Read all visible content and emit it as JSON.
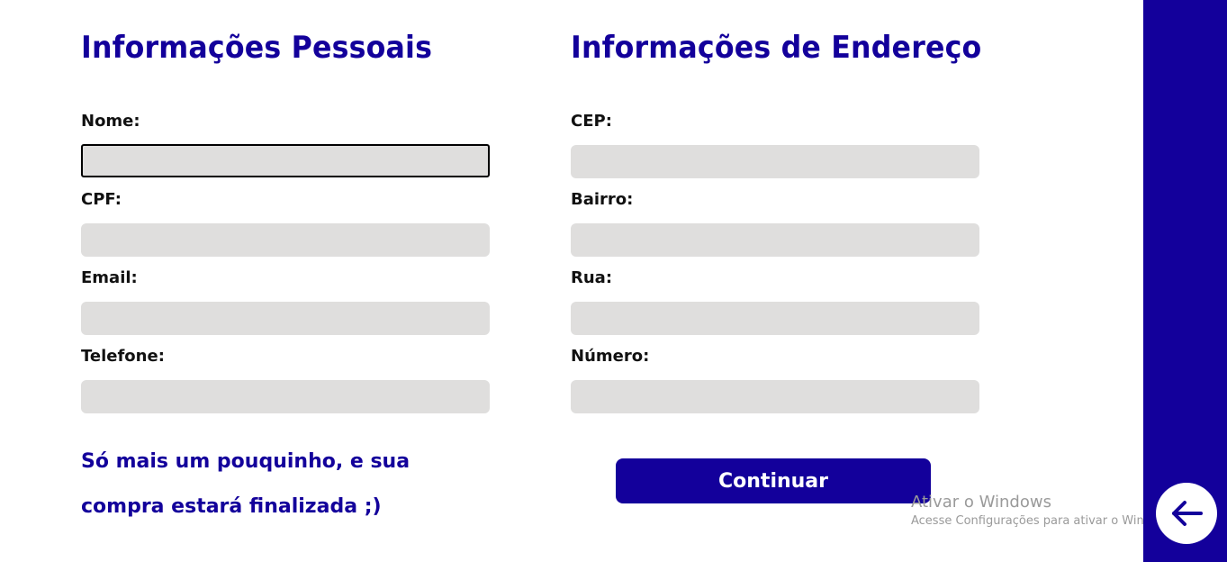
{
  "colors": {
    "accent": "#13009b",
    "input_background": "#dfdedd"
  },
  "personal": {
    "title": "Informações Pessoais",
    "fields": [
      {
        "label": "Nome:",
        "value": "",
        "focused": true
      },
      {
        "label": "CPF:",
        "value": ""
      },
      {
        "label": "Email:",
        "value": ""
      },
      {
        "label": "Telefone:",
        "value": ""
      }
    ]
  },
  "address": {
    "title": "Informações de Endereço",
    "fields": [
      {
        "label": "CEP:",
        "value": ""
      },
      {
        "label": "Bairro:",
        "value": ""
      },
      {
        "label": "Rua:",
        "value": ""
      },
      {
        "label": "Número:",
        "value": ""
      }
    ]
  },
  "note": "Só mais um pouquinho, e sua compra estará finalizada ;)",
  "continue_label": "Continuar",
  "back_button": {
    "icon": "arrow-left-icon"
  },
  "watermark": {
    "title": "Ativar o Windows",
    "subtitle": "Acesse Configurações para ativar o Windows."
  }
}
